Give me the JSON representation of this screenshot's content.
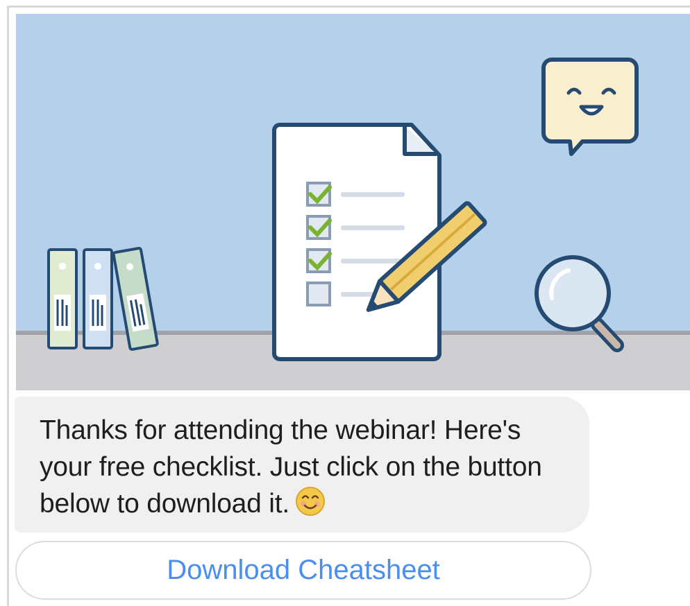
{
  "message": {
    "text": "Thanks for attending the webinar! Here's your free checklist. Just click on the button below to download it.",
    "emoji": "smiling-face-emoji"
  },
  "button": {
    "label": "Download Cheatsheet"
  },
  "colors": {
    "sky": "#b4d0ea",
    "floor": "#cfcfd1",
    "outline": "#254b73",
    "check": "#7ab32e",
    "pencil": "#f1ce6d",
    "button_text": "#4a8ef0",
    "bubble_bg": "#f0f0f0"
  }
}
